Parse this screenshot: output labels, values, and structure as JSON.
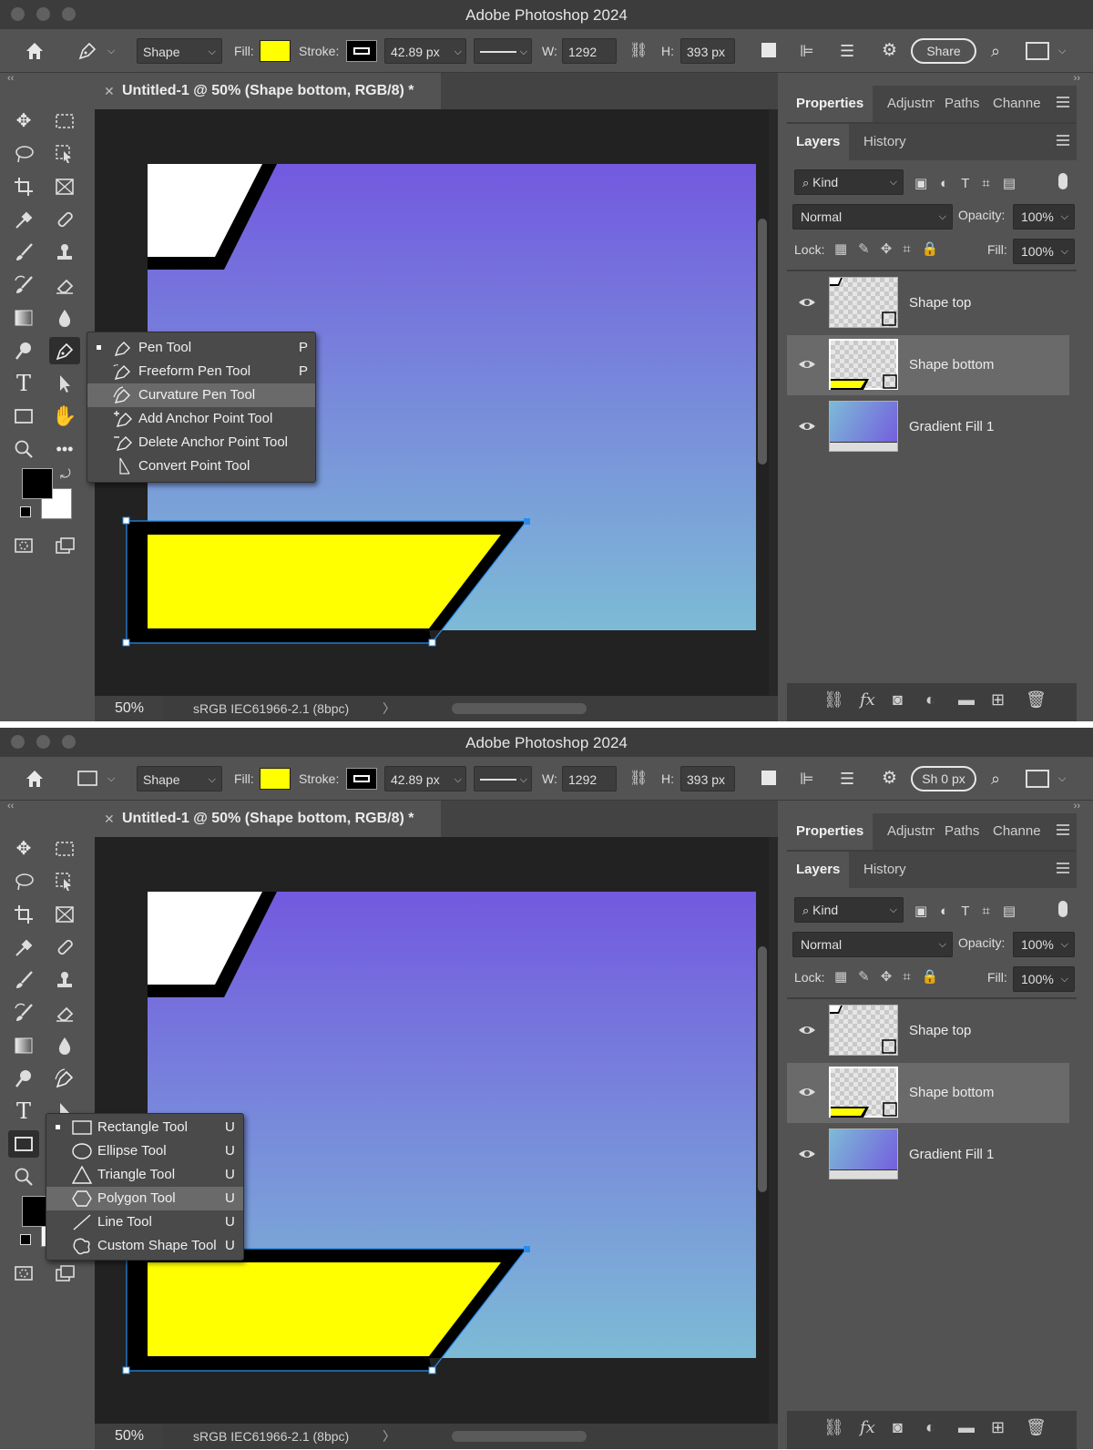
{
  "app": {
    "title": "Adobe Photoshop 2024"
  },
  "options": {
    "mode": "Shape",
    "fill_label": "Fill:",
    "stroke_label": "Stroke:",
    "stroke_width": "42.89 px",
    "w_label": "W:",
    "w_value": "1292 px",
    "h_label": "H:",
    "h_value": "393 px",
    "share_label_1": "Share",
    "share_label_2": "Sh 0 px",
    "fill_color": "#FFFF00"
  },
  "document": {
    "tab_title": "Untitled-1 @ 50% (Shape bottom, RGB/8) *",
    "zoom": "50%",
    "color_profile": "sRGB IEC61966-2.1 (8bpc)"
  },
  "panels": {
    "top_tabs": [
      "Properties",
      "Adjustm",
      "Paths",
      "Channe"
    ],
    "layer_tabs": [
      "Layers",
      "History"
    ],
    "filter_kind": "Kind",
    "blend_mode": "Normal",
    "opacity_label": "Opacity:",
    "opacity_value": "100%",
    "lock_label": "Lock:",
    "fill_label": "Fill:",
    "fill_value": "100%",
    "layers": [
      {
        "name": "Shape top",
        "selected": false
      },
      {
        "name": "Shape bottom",
        "selected": true
      },
      {
        "name": "Gradient Fill 1",
        "selected": false
      }
    ]
  },
  "pen_flyout": {
    "items": [
      {
        "label": "Pen Tool",
        "key": "P",
        "icon": "pen-icon"
      },
      {
        "label": "Freeform Pen Tool",
        "key": "P",
        "icon": "freeform-pen-icon"
      },
      {
        "label": "Curvature Pen Tool",
        "key": "",
        "icon": "curvature-pen-icon"
      },
      {
        "label": "Add Anchor Point Tool",
        "key": "",
        "icon": "add-anchor-icon"
      },
      {
        "label": "Delete Anchor Point Tool",
        "key": "",
        "icon": "delete-anchor-icon"
      },
      {
        "label": "Convert Point Tool",
        "key": "",
        "icon": "convert-point-icon"
      }
    ],
    "highlighted": "Curvature Pen Tool"
  },
  "shape_flyout": {
    "items": [
      {
        "label": "Rectangle Tool",
        "key": "U",
        "icon": "rectangle-icon"
      },
      {
        "label": "Ellipse Tool",
        "key": "U",
        "icon": "ellipse-icon"
      },
      {
        "label": "Triangle Tool",
        "key": "U",
        "icon": "triangle-icon"
      },
      {
        "label": "Polygon Tool",
        "key": "U",
        "icon": "polygon-icon"
      },
      {
        "label": "Line Tool",
        "key": "U",
        "icon": "line-icon"
      },
      {
        "label": "Custom Shape Tool",
        "key": "U",
        "icon": "custom-shape-icon"
      }
    ],
    "highlighted": "Polygon Tool"
  },
  "colors": {
    "gradient_top": "#7359DF",
    "gradient_bottom": "#7DBBD6",
    "shape_fill": "#FFFF00",
    "selection": "#2A8CEB"
  }
}
